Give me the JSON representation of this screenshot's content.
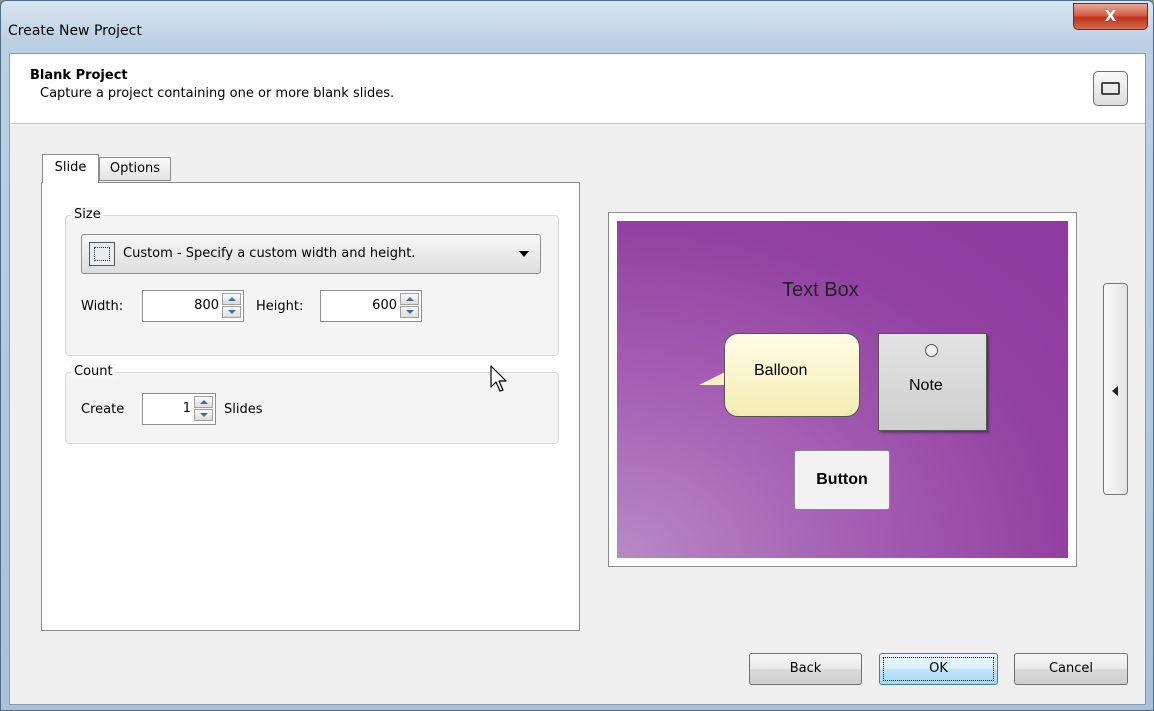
{
  "window": {
    "title": "Create New Project",
    "close_label": "X"
  },
  "header": {
    "title": "Blank Project",
    "subtitle": "Capture a project containing one or more blank slides."
  },
  "tabs": [
    {
      "label": "Slide",
      "active": true
    },
    {
      "label": "Options",
      "active": false
    }
  ],
  "size": {
    "group_label": "Size",
    "preset_value": "Custom - Specify a custom width and height.",
    "width_label": "Width:",
    "width_value": "800",
    "height_label": "Height:",
    "height_value": "600"
  },
  "count": {
    "group_label": "Count",
    "create_label": "Create",
    "create_value": "1",
    "slides_label": "Slides"
  },
  "preview": {
    "textbox": "Text Box",
    "balloon": "Balloon",
    "note": "Note",
    "button": "Button"
  },
  "footer": {
    "back_label": "Back",
    "ok_label": "OK",
    "cancel_label": "Cancel"
  },
  "colors": {
    "slide_purple": "#9443a3",
    "balloon_yellow": "#f7f0c3",
    "ok_blue": "#bee6fd"
  }
}
